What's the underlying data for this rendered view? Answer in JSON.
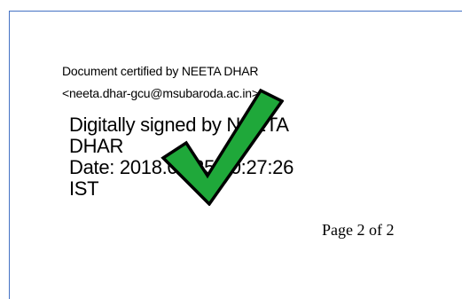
{
  "certification": {
    "line1": "Document certified by NEETA DHAR",
    "line2": "<neeta.dhar-gcu@msubaroda.ac.in>."
  },
  "signature": {
    "line1": "Digitally signed by NEETA",
    "line2": "DHAR",
    "line3": "Date: 2018.06.25 00:27:26",
    "line4": "IST",
    "icon": "checkmark-icon"
  },
  "footer": {
    "page_label": "Page 2 of 2"
  },
  "colors": {
    "frame_border": "#4472c4",
    "checkmark_fill": "#1fa83a",
    "checkmark_outline": "#000000"
  }
}
